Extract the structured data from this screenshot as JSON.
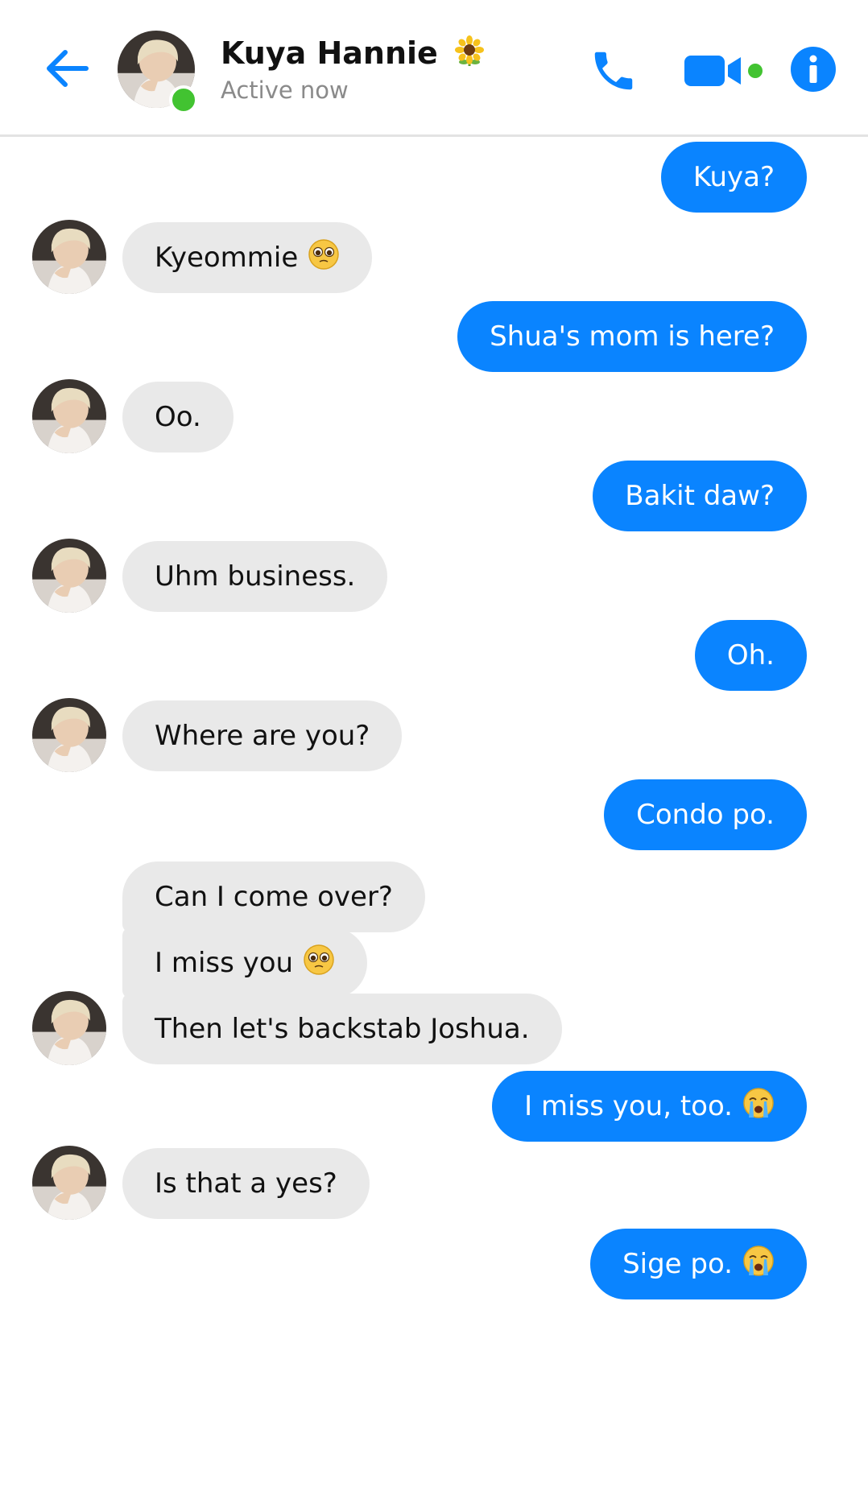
{
  "header": {
    "contact_name": "Kuya Hannie",
    "status": "Active now",
    "name_emoji": "sunflower-icon",
    "accent_color": "#0a84ff",
    "presence_color": "#42c331"
  },
  "messages": [
    {
      "side": "out",
      "text": "Kuya?"
    },
    {
      "side": "in",
      "text": "Kyeommie",
      "emoji": "pleading-face-icon"
    },
    {
      "side": "out",
      "text": "Shua's mom is here?"
    },
    {
      "side": "in",
      "text": "Oo."
    },
    {
      "side": "out",
      "text": "Bakit daw?"
    },
    {
      "side": "in",
      "text": "Uhm business."
    },
    {
      "side": "out",
      "text": "Oh."
    },
    {
      "side": "in",
      "text": "Where are you?"
    },
    {
      "side": "out",
      "text": "Condo po."
    },
    {
      "side": "in",
      "text": "Can I come over?"
    },
    {
      "side": "in",
      "text": "I miss you",
      "emoji": "pleading-face-icon"
    },
    {
      "side": "in",
      "text": "Then let's backstab Joshua."
    },
    {
      "side": "out",
      "text": "I miss you, too.",
      "emoji": "crying-face-icon"
    },
    {
      "side": "in",
      "text": "Is that a yes?"
    },
    {
      "side": "out",
      "text": "Sige po.",
      "emoji": "crying-face-icon"
    }
  ]
}
